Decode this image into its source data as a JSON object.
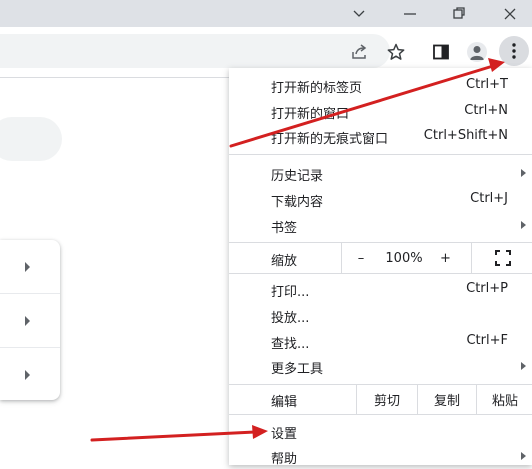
{
  "window": {
    "minimize_icon": "chevron-down",
    "restore_icon": "minimize-line",
    "maximize_icon": "restore-squares",
    "close_icon": "close"
  },
  "toolbar": {
    "share_icon": "share",
    "bookmark_icon": "star",
    "sidepanel_icon": "side-panel",
    "profile_icon": "person",
    "menu_icon": "vertical-dots"
  },
  "menu": {
    "new_tab": {
      "label": "打开新的标签页",
      "shortcut": "Ctrl+T"
    },
    "new_window": {
      "label": "打开新的窗口",
      "shortcut": "Ctrl+N"
    },
    "new_incognito": {
      "label": "打开新的无痕式窗口",
      "shortcut": "Ctrl+Shift+N"
    },
    "history": {
      "label": "历史记录"
    },
    "downloads": {
      "label": "下载内容",
      "shortcut": "Ctrl+J"
    },
    "bookmarks": {
      "label": "书签"
    },
    "zoom": {
      "label": "缩放",
      "minus": "–",
      "value": "100%",
      "plus": "+"
    },
    "print": {
      "label": "打印...",
      "shortcut": "Ctrl+P"
    },
    "cast": {
      "label": "投放..."
    },
    "find": {
      "label": "查找...",
      "shortcut": "Ctrl+F"
    },
    "more_tools": {
      "label": "更多工具"
    },
    "edit": {
      "label": "编辑",
      "cut": "剪切",
      "copy": "复制",
      "paste": "粘贴"
    },
    "settings": {
      "label": "设置"
    },
    "help": {
      "label": "帮助"
    }
  },
  "colors": {
    "annotation_arrow": "#d32020",
    "titlebar": "#dee1e6"
  }
}
